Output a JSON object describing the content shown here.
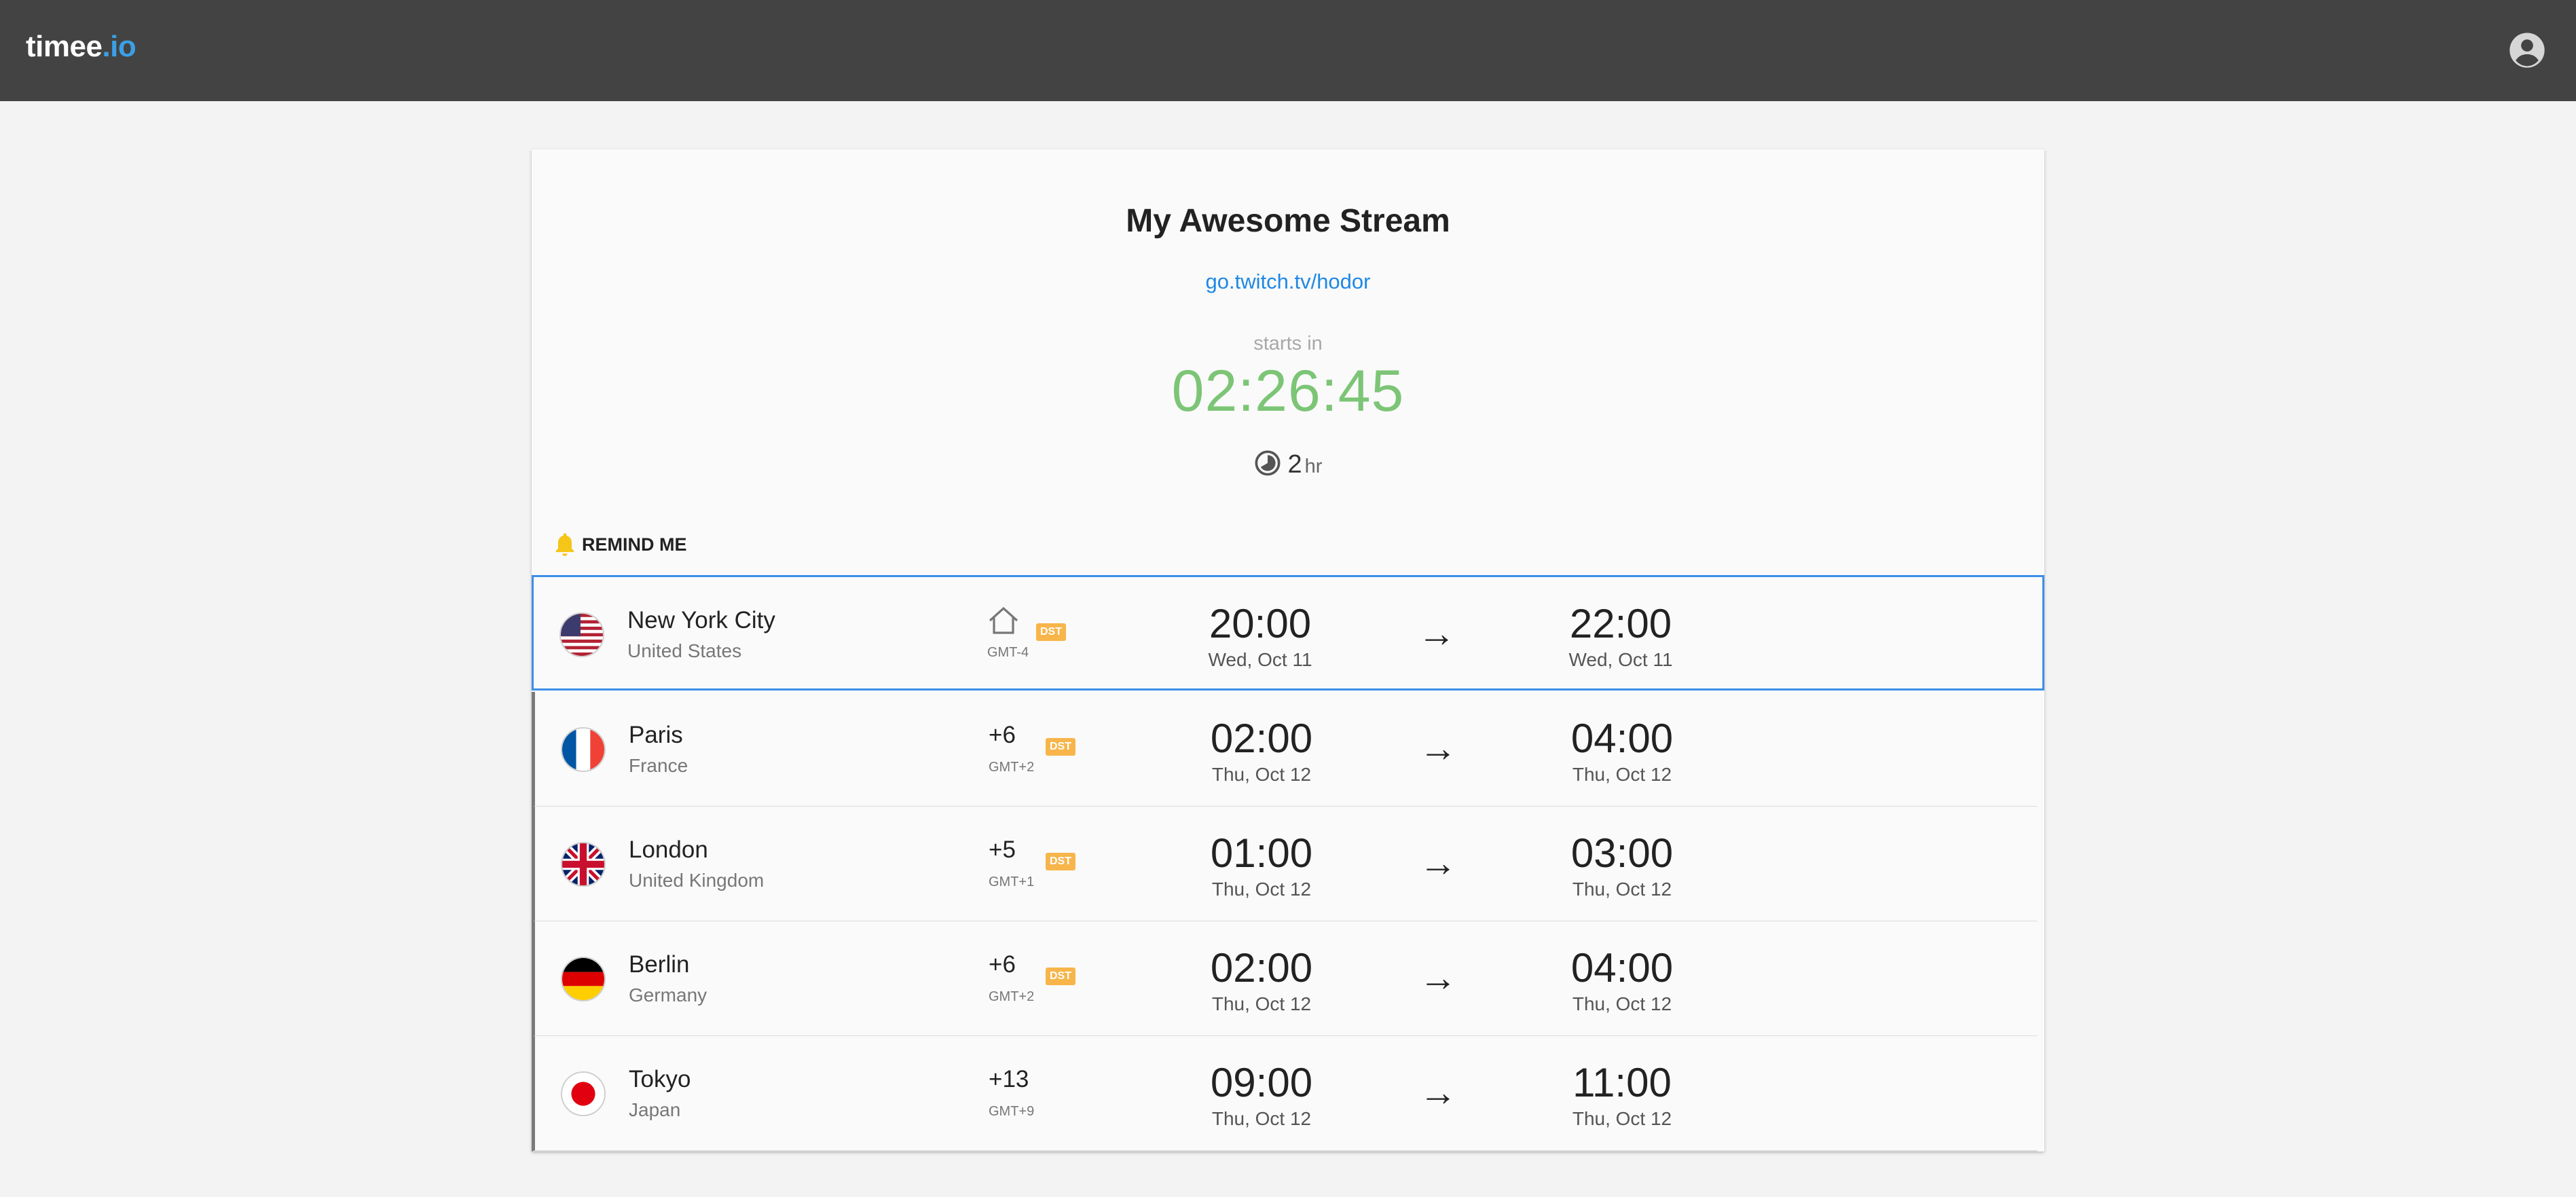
{
  "header": {
    "logo_main": "timee",
    "logo_accent": ".io",
    "account_icon": "account-circle-icon"
  },
  "event": {
    "title": "My Awesome Stream",
    "link": "go.twitch.tv/hodor",
    "starts_label": "starts in",
    "countdown": "02:26:45",
    "duration_value": "2",
    "duration_unit": "hr",
    "remind_label": "REMIND ME"
  },
  "colors": {
    "header_bg": "#434343",
    "accent": "#3ba0e6",
    "countdown": "#7cc576",
    "dst_badge": "#f7b54a",
    "selected_border": "#3d8ee8"
  },
  "rows": [
    {
      "city": "New York City",
      "country": "United States",
      "offset": "",
      "home": true,
      "gmt": "GMT-4",
      "dst": "DST",
      "start_time": "20:00",
      "start_date": "Wed, Oct 11",
      "end_time": "22:00",
      "end_date": "Wed, Oct 11",
      "flag": "us-flag"
    },
    {
      "city": "Paris",
      "country": "France",
      "offset": "+6",
      "home": false,
      "gmt": "GMT+2",
      "dst": "DST",
      "start_time": "02:00",
      "start_date": "Thu, Oct 12",
      "end_time": "04:00",
      "end_date": "Thu, Oct 12",
      "flag": "fr-flag"
    },
    {
      "city": "London",
      "country": "United Kingdom",
      "offset": "+5",
      "home": false,
      "gmt": "GMT+1",
      "dst": "DST",
      "start_time": "01:00",
      "start_date": "Thu, Oct 12",
      "end_time": "03:00",
      "end_date": "Thu, Oct 12",
      "flag": "uk-flag"
    },
    {
      "city": "Berlin",
      "country": "Germany",
      "offset": "+6",
      "home": false,
      "gmt": "GMT+2",
      "dst": "DST",
      "start_time": "02:00",
      "start_date": "Thu, Oct 12",
      "end_time": "04:00",
      "end_date": "Thu, Oct 12",
      "flag": "de-flag"
    },
    {
      "city": "Tokyo",
      "country": "Japan",
      "offset": "+13",
      "home": false,
      "gmt": "GMT+9",
      "dst": "",
      "start_time": "09:00",
      "start_date": "Thu, Oct 12",
      "end_time": "11:00",
      "end_date": "Thu, Oct 12",
      "flag": "jp-flag"
    }
  ]
}
